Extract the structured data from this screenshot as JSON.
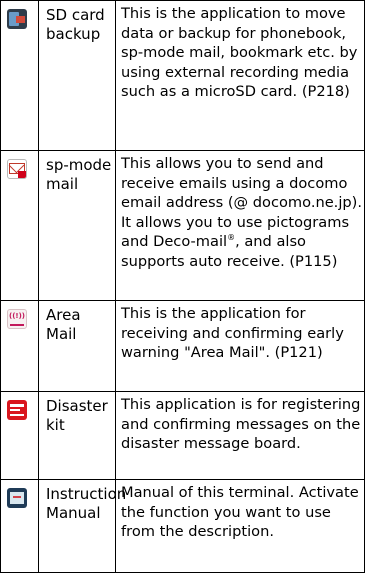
{
  "rows": [
    {
      "icon": "sd-card-backup-icon",
      "name": "SD card backup",
      "description": "This is the application to move data or backup for phonebook, sp-mode mail, bookmark etc. by using external recording media such as a microSD card. (P218)"
    },
    {
      "icon": "sp-mode-mail-icon",
      "name": "sp-mode mail",
      "description_before_mark": "This allows you to send and receive emails using a docomo email address (@ docomo.ne.jp). It allows you to use pictograms and Deco-mail",
      "registered_mark": "®",
      "description_after_mark": ", and also supports auto receive. (P115)"
    },
    {
      "icon": "area-mail-icon",
      "name": "Area Mail",
      "description": "This is the application for receiving and confirming early warning \"Area Mail\". (P121)"
    },
    {
      "icon": "disaster-kit-icon",
      "name": "Disaster kit",
      "description": "This application is for registering and confirming messages on the disaster message board."
    },
    {
      "icon": "instruction-manual-icon",
      "name": "Instruction Manual",
      "description": "Manual of this terminal. Activate the function you want to use from the description."
    }
  ]
}
